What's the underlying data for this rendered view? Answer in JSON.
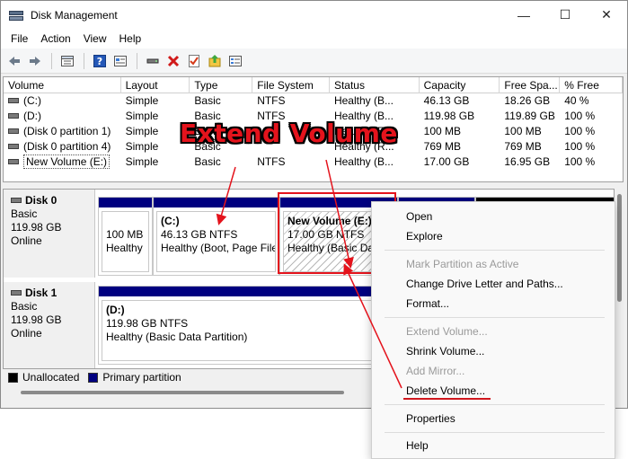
{
  "window": {
    "title": "Disk Management",
    "controls": {
      "minimize": "—",
      "maximize": "☐",
      "close": "✕"
    }
  },
  "menu": [
    "File",
    "Action",
    "View",
    "Help"
  ],
  "toolbar": {
    "icons": [
      "back-icon",
      "forward-icon",
      "disk-list-icon",
      "help-icon",
      "properties-icon",
      "connect-icon",
      "delete-icon",
      "check-icon",
      "upload-icon",
      "settings-icon"
    ]
  },
  "volumes": {
    "headers": [
      "Volume",
      "Layout",
      "Type",
      "File System",
      "Status",
      "Capacity",
      "Free Spa...",
      "% Free"
    ],
    "rows": [
      {
        "volume": "(C:)",
        "layout": "Simple",
        "type": "Basic",
        "fs": "NTFS",
        "status": "Healthy (B...",
        "capacity": "46.13 GB",
        "free": "18.26 GB",
        "pct": "40 %"
      },
      {
        "volume": "(D:)",
        "layout": "Simple",
        "type": "Basic",
        "fs": "NTFS",
        "status": "Healthy (B...",
        "capacity": "119.98 GB",
        "free": "119.89 GB",
        "pct": "100 %"
      },
      {
        "volume": "(Disk 0 partition 1)",
        "layout": "Simple",
        "type": "Basic",
        "fs": "",
        "status": "Healthy (E...",
        "capacity": "100 MB",
        "free": "100 MB",
        "pct": "100 %"
      },
      {
        "volume": "(Disk 0 partition 4)",
        "layout": "Simple",
        "type": "Basic",
        "fs": "",
        "status": "Healthy (R...",
        "capacity": "769 MB",
        "free": "769 MB",
        "pct": "100 %"
      },
      {
        "volume": "New Volume (E:)",
        "layout": "Simple",
        "type": "Basic",
        "fs": "NTFS",
        "status": "Healthy (B...",
        "capacity": "17.00 GB",
        "free": "16.95 GB",
        "pct": "100 %"
      }
    ]
  },
  "disks": [
    {
      "name": "Disk 0",
      "type": "Basic",
      "size": "119.98 GB",
      "state": "Online",
      "partitions": [
        {
          "name": "",
          "size": "100 MB",
          "status": "Healthy"
        },
        {
          "name": "(C:)",
          "size": "46.13 GB NTFS",
          "status": "Healthy (Boot, Page File,"
        },
        {
          "name": "New Volume  (E:)",
          "size": "17.00 GB NTFS",
          "status": "Healthy (Basic Data"
        }
      ]
    },
    {
      "name": "Disk 1",
      "type": "Basic",
      "size": "119.98 GB",
      "state": "Online",
      "partitions": [
        {
          "name": "(D:)",
          "size": "119.98 GB NTFS",
          "status": "Healthy (Basic Data Partition)"
        }
      ]
    }
  ],
  "legend": [
    {
      "label": "Unallocated",
      "color": "#000000"
    },
    {
      "label": "Primary partition",
      "color": "#000080"
    }
  ],
  "context_menu": {
    "items": [
      {
        "label": "Open",
        "enabled": true
      },
      {
        "label": "Explore",
        "enabled": true
      },
      {
        "label": "Mark Partition as Active",
        "enabled": false
      },
      {
        "label": "Change Drive Letter and Paths...",
        "enabled": true
      },
      {
        "label": "Format...",
        "enabled": true
      },
      {
        "label": "Extend Volume...",
        "enabled": false
      },
      {
        "label": "Shrink Volume...",
        "enabled": true
      },
      {
        "label": "Add Mirror...",
        "enabled": false
      },
      {
        "label": "Delete Volume...",
        "enabled": true
      },
      {
        "label": "Properties",
        "enabled": true
      },
      {
        "label": "Help",
        "enabled": true
      }
    ]
  },
  "annotation": {
    "text": "Extend Volume",
    "color": "#e4131c"
  }
}
